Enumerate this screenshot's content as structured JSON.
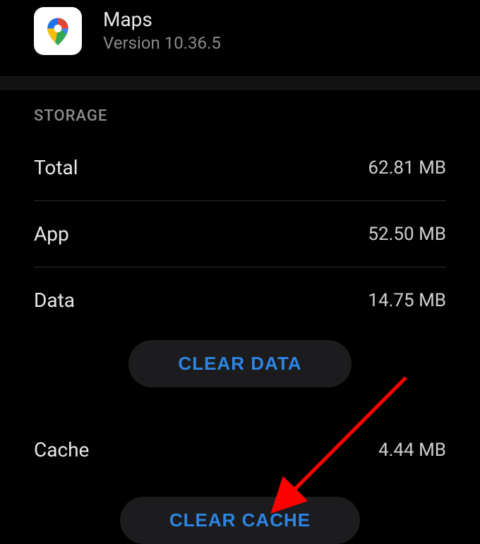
{
  "header": {
    "app_name": "Maps",
    "version_label": "Version 10.36.5"
  },
  "section": {
    "title": "STORAGE",
    "rows": {
      "total": {
        "label": "Total",
        "value": "62.81 MB"
      },
      "app": {
        "label": "App",
        "value": "52.50 MB"
      },
      "data": {
        "label": "Data",
        "value": "14.75 MB"
      },
      "cache": {
        "label": "Cache",
        "value": "4.44 MB"
      }
    },
    "buttons": {
      "clear_data": "CLEAR DATA",
      "clear_cache": "CLEAR CACHE"
    }
  },
  "colors": {
    "accent": "#2d85e2",
    "bg": "#000000"
  }
}
